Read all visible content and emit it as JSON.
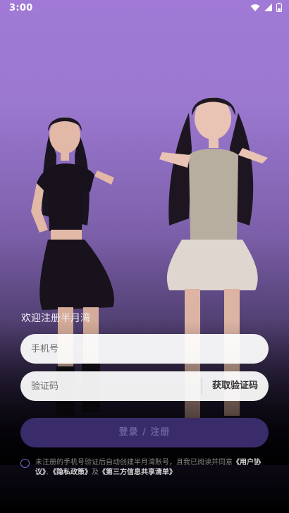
{
  "status_bar": {
    "time": "3:00",
    "icons": [
      "wifi-icon",
      "signal-icon",
      "battery-icon"
    ]
  },
  "welcome_text": "欢迎注册半月湾",
  "phone_field": {
    "placeholder": "手机号",
    "value": ""
  },
  "code_field": {
    "placeholder": "验证码",
    "value": "",
    "get_code_label": "获取验证码"
  },
  "login_button_label": "登录 / 注册",
  "agreement": {
    "prefix": "未注册的手机号验证后自动创建半月湾账号，且我已阅读并同意",
    "user_agreement": "《用户协议》",
    "sep1": "、",
    "privacy_policy": "《隐私政策》",
    "sep2": "及",
    "third_party_list": "《第三方信息共享清单》"
  },
  "colors": {
    "background_top": "#a07ad6",
    "login_button": "#3a2c6a",
    "radio_accent": "#7b6cd6"
  }
}
